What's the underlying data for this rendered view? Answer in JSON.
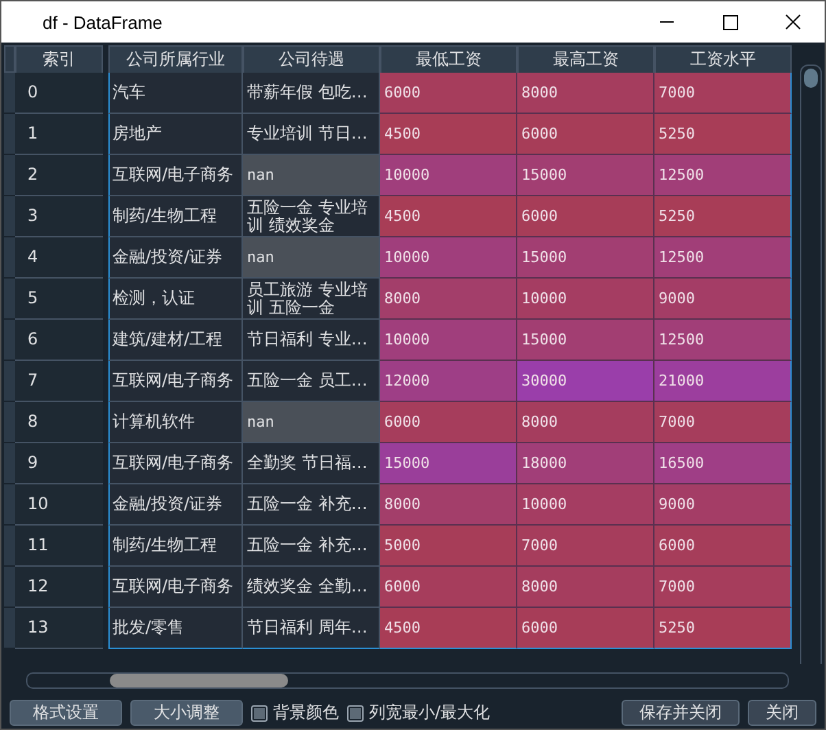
{
  "window": {
    "title": "df - DataFrame"
  },
  "table": {
    "index_header": "索引",
    "columns": [
      "公司所属行业",
      "公司待遇",
      "最低工资",
      "最高工资",
      "工资水平"
    ],
    "rows": [
      {
        "index": "0",
        "industry": "汽车",
        "benefits": {
          "text": "带薪年假  包吃…",
          "missing": false
        },
        "values": [
          {
            "text": "6000",
            "color": "#a63d5c"
          },
          {
            "text": "8000",
            "color": "#a53d5e"
          },
          {
            "text": "7000",
            "color": "#a63d5c"
          }
        ]
      },
      {
        "index": "1",
        "industry": "房地产",
        "benefits": {
          "text": "专业培训  节日…",
          "missing": false
        },
        "values": [
          {
            "text": "4500",
            "color": "#a83d56"
          },
          {
            "text": "6000",
            "color": "#a73d58"
          },
          {
            "text": "5250",
            "color": "#a83d57"
          }
        ]
      },
      {
        "index": "2",
        "industry": "互联网/电子商务",
        "benefits": {
          "text": "nan",
          "missing": true
        },
        "values": [
          {
            "text": "10000",
            "color": "#a03e7c"
          },
          {
            "text": "15000",
            "color": "#a23e72"
          },
          {
            "text": "12500",
            "color": "#a13e78"
          }
        ]
      },
      {
        "index": "3",
        "industry": "制药/生物工程",
        "benefits": {
          "text": "五险一金  专业培训  绩效奖金",
          "missing": false
        },
        "values": [
          {
            "text": "4500",
            "color": "#a83d56"
          },
          {
            "text": "6000",
            "color": "#a73d58"
          },
          {
            "text": "5250",
            "color": "#a83d57"
          }
        ]
      },
      {
        "index": "4",
        "industry": "金融/投资/证券",
        "benefits": {
          "text": "nan",
          "missing": true
        },
        "values": [
          {
            "text": "10000",
            "color": "#a03e7c"
          },
          {
            "text": "15000",
            "color": "#a23e72"
          },
          {
            "text": "12500",
            "color": "#a13e78"
          }
        ]
      },
      {
        "index": "5",
        "industry": "检测，认证",
        "benefits": {
          "text": "员工旅游  专业培训  五险一金",
          "missing": false
        },
        "values": [
          {
            "text": "8000",
            "color": "#a33e6a"
          },
          {
            "text": "10000",
            "color": "#a53d62"
          },
          {
            "text": "9000",
            "color": "#a43d66"
          }
        ]
      },
      {
        "index": "6",
        "industry": "建筑/建材/工程",
        "benefits": {
          "text": "节日福利  专业…",
          "missing": false
        },
        "values": [
          {
            "text": "10000",
            "color": "#a03e7c"
          },
          {
            "text": "15000",
            "color": "#a23e72"
          },
          {
            "text": "12500",
            "color": "#a13e78"
          }
        ]
      },
      {
        "index": "7",
        "industry": "互联网/电子商务",
        "benefits": {
          "text": "五险一金  员工…",
          "missing": false
        },
        "values": [
          {
            "text": "12000",
            "color": "#9e3e86"
          },
          {
            "text": "30000",
            "color": "#9a3eaa"
          },
          {
            "text": "21000",
            "color": "#9c3e9e"
          }
        ]
      },
      {
        "index": "8",
        "industry": "计算机软件",
        "benefits": {
          "text": "nan",
          "missing": true
        },
        "values": [
          {
            "text": "6000",
            "color": "#a63d5c"
          },
          {
            "text": "8000",
            "color": "#a53d5e"
          },
          {
            "text": "7000",
            "color": "#a63d5c"
          }
        ]
      },
      {
        "index": "9",
        "industry": "互联网/电子商务",
        "benefits": {
          "text": "全勤奖  节日福…",
          "missing": false
        },
        "values": [
          {
            "text": "15000",
            "color": "#9a3e9a"
          },
          {
            "text": "18000",
            "color": "#a13e78"
          },
          {
            "text": "16500",
            "color": "#9f3e86"
          }
        ]
      },
      {
        "index": "10",
        "industry": "金融/投资/证券",
        "benefits": {
          "text": "五险一金  补充…",
          "missing": false
        },
        "values": [
          {
            "text": "8000",
            "color": "#a33e6a"
          },
          {
            "text": "10000",
            "color": "#a53d62"
          },
          {
            "text": "9000",
            "color": "#a43d66"
          }
        ]
      },
      {
        "index": "11",
        "industry": "制药/生物工程",
        "benefits": {
          "text": "五险一金  补充…",
          "missing": false
        },
        "values": [
          {
            "text": "5000",
            "color": "#a73d58"
          },
          {
            "text": "7000",
            "color": "#a63d5c"
          },
          {
            "text": "6000",
            "color": "#a63d5a"
          }
        ]
      },
      {
        "index": "12",
        "industry": "互联网/电子商务",
        "benefits": {
          "text": "绩效奖金  全勤…",
          "missing": false
        },
        "values": [
          {
            "text": "6000",
            "color": "#a63d5c"
          },
          {
            "text": "8000",
            "color": "#a53d5e"
          },
          {
            "text": "7000",
            "color": "#a63d5c"
          }
        ]
      },
      {
        "index": "13",
        "industry": "批发/零售",
        "benefits": {
          "text": "节日福利  周年…",
          "missing": false
        },
        "values": [
          {
            "text": "4500",
            "color": "#a83d56"
          },
          {
            "text": "6000",
            "color": "#a73d58"
          },
          {
            "text": "5250",
            "color": "#a83d57"
          }
        ]
      }
    ]
  },
  "buttons": [
    "格式设置",
    "大小调整"
  ],
  "checkboxes": [
    {
      "label": "背景颜色",
      "checked": false
    },
    {
      "label": "列宽最小/最大化",
      "checked": false
    }
  ],
  "dialog_buttons": [
    "保存并关闭",
    "关闭"
  ]
}
